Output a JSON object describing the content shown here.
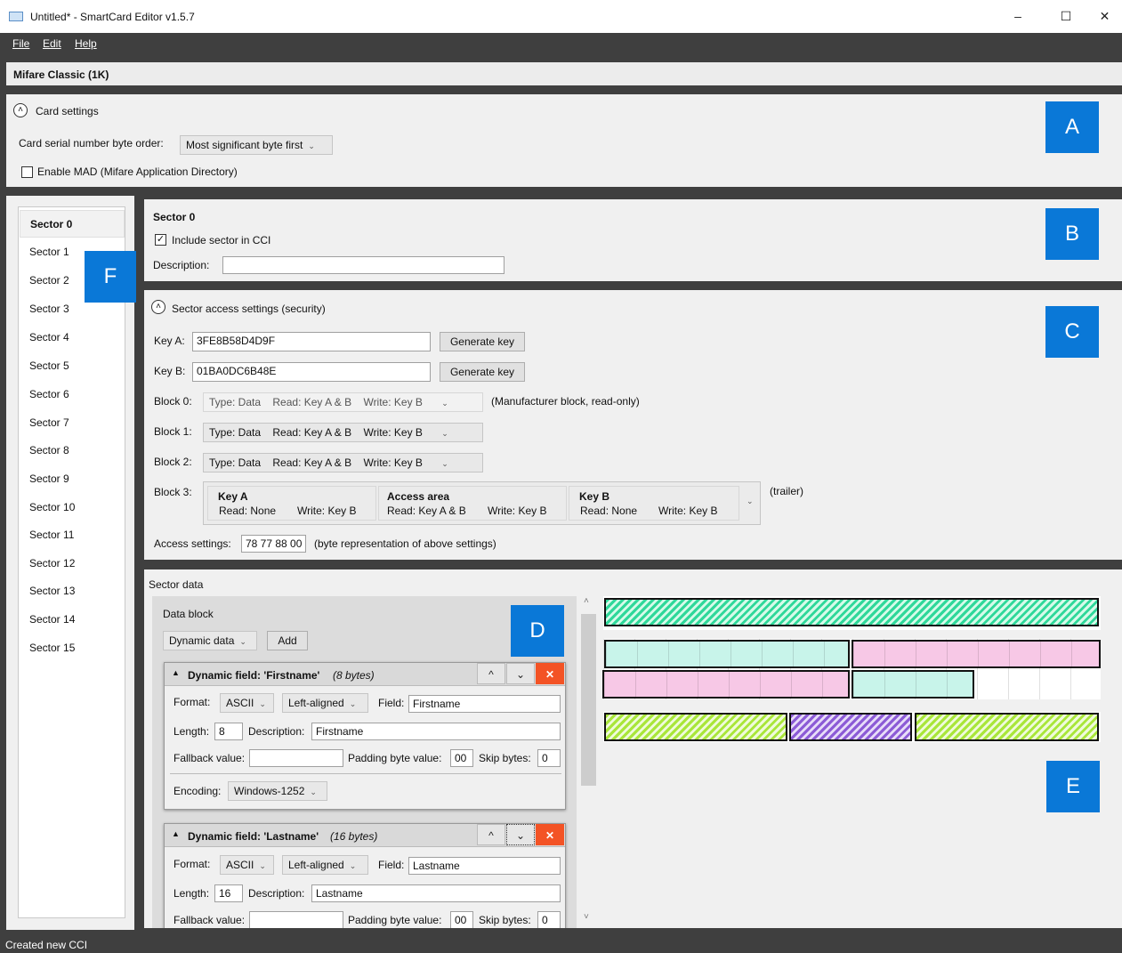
{
  "window": {
    "title": "Untitled* - SmartCard Editor v1.5.7",
    "minimize_glyph": "–",
    "maximize_glyph": "☐",
    "close_glyph": "✕"
  },
  "menu": {
    "file": "File",
    "edit": "Edit",
    "help": "Help"
  },
  "card_type": "Mifare Classic (1K)",
  "card_settings": {
    "header": "Card settings",
    "byte_order_label": "Card serial number byte order:",
    "byte_order_value": "Most significant byte first",
    "enable_mad_label": "Enable MAD (Mifare Application Directory)"
  },
  "badges": {
    "a": "A",
    "b": "B",
    "c": "C",
    "d": "D",
    "e": "E",
    "f": "F"
  },
  "sectors": {
    "items": [
      "Sector 0",
      "Sector 1",
      "Sector 2",
      "Sector 3",
      "Sector 4",
      "Sector 5",
      "Sector 6",
      "Sector 7",
      "Sector 8",
      "Sector 9",
      "Sector 10",
      "Sector 11",
      "Sector 12",
      "Sector 13",
      "Sector 14",
      "Sector 15"
    ],
    "selected": "Sector 0"
  },
  "sector_info": {
    "title": "Sector 0",
    "include_label": "Include sector in CCI",
    "include_checked": true,
    "description_label": "Description:",
    "description_value": ""
  },
  "access": {
    "header": "Sector access settings (security)",
    "key_a_label": "Key A:",
    "key_a_value": "3FE8B58D4D9F",
    "key_b_label": "Key B:",
    "key_b_value": "01BA0DC6B48E",
    "generate_label": "Generate key",
    "blocks": [
      {
        "label": "Block 0:",
        "type": "Type: Data",
        "read": "Read: Key A & B",
        "write": "Write: Key B",
        "note": "(Manufacturer block, read-only)"
      },
      {
        "label": "Block 1:",
        "type": "Type: Data",
        "read": "Read: Key A & B",
        "write": "Write: Key B"
      },
      {
        "label": "Block 2:",
        "type": "Type: Data",
        "read": "Read: Key A & B",
        "write": "Write: Key B"
      }
    ],
    "block3": {
      "label": "Block 3:",
      "key_a_title": "Key A",
      "key_a_read": "Read: None",
      "key_a_write": "Write: Key B",
      "access_title": "Access area",
      "access_read": "Read: Key A & B",
      "access_write": "Write: Key B",
      "key_b_title": "Key B",
      "key_b_read": "Read: None",
      "key_b_write": "Write: Key B",
      "note": "(trailer)"
    },
    "access_settings_label": "Access settings:",
    "access_settings_value": "78 77 88 00",
    "access_settings_note": "(byte representation of above settings)"
  },
  "sector_data": {
    "header": "Sector data",
    "data_block_label": "Data block",
    "type_value": "Dynamic data",
    "add_label": "Add",
    "fields": [
      {
        "title": "Dynamic field: 'Firstname'",
        "size": "(8 bytes)",
        "format_label": "Format:",
        "format_value": "ASCII",
        "align_value": "Left-aligned",
        "field_label": "Field:",
        "field_value": "Firstname",
        "length_label": "Length:",
        "length_value": "8",
        "description_label": "Description:",
        "description_value": "Firstname",
        "fallback_label": "Fallback value:",
        "fallback_value": "",
        "padding_label": "Padding byte value:",
        "padding_value": "00",
        "skip_label": "Skip bytes:",
        "skip_value": "0",
        "encoding_label": "Encoding:",
        "encoding_value": "Windows-1252"
      },
      {
        "title": "Dynamic field: 'Lastname'",
        "size": "(16 bytes)",
        "format_label": "Format:",
        "format_value": "ASCII",
        "align_value": "Left-aligned",
        "field_label": "Field:",
        "field_value": "Lastname",
        "length_label": "Length:",
        "length_value": "16",
        "description_label": "Description:",
        "description_value": "Lastname",
        "fallback_label": "Fallback value:",
        "fallback_value": "",
        "padding_label": "Padding byte value:",
        "padding_value": "00",
        "skip_label": "Skip bytes:",
        "skip_value": "0"
      }
    ]
  },
  "layout_colors": {
    "hatched_green": "#2fd89a",
    "cyan_fill": "#c8f4ea",
    "pink_fill": "#f7c8e6",
    "hatched_lime": "#a9e63a",
    "hatched_purple": "#8c5bd6",
    "accent_blue": "#0a78d7",
    "delete_red": "#f35325"
  },
  "status": "Created new CCI"
}
